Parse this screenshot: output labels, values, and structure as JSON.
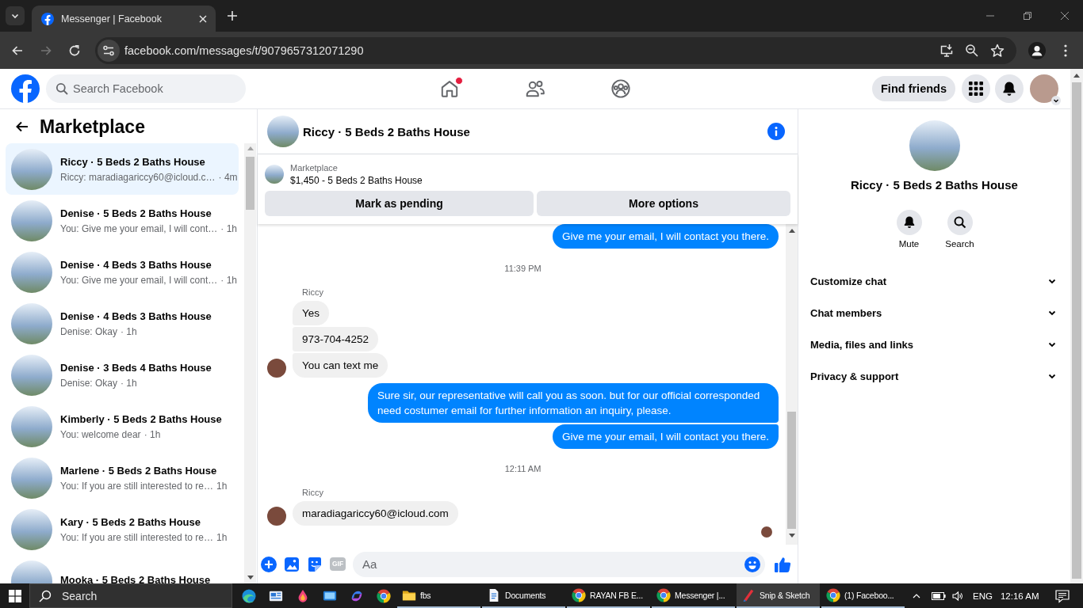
{
  "browser": {
    "tabs": [
      {
        "title": "Messenger | Facebook",
        "selected": true
      }
    ],
    "nav": [
      {
        "kind": "back",
        "disabled": false
      },
      {
        "kind": "forward",
        "disabled": true
      },
      {
        "kind": "reload",
        "disabled": false
      }
    ],
    "url": "facebook.com/messages/t/9079657312071290"
  },
  "header": {
    "search": {
      "placeholder": "Search Facebook"
    },
    "nav": [
      {
        "kind": "home",
        "notification": true
      },
      {
        "kind": "friends",
        "notification": false
      },
      {
        "kind": "groups",
        "notification": false
      }
    ],
    "find_friends": "Find friends"
  },
  "sidebar": {
    "title": "Marketplace",
    "conversations": [
      {
        "title": "Riccy · 5 Beds 2 Baths House",
        "preview": "Riccy: maradiagariccy60@icloud.c…",
        "time": "· 4m",
        "selected": true
      },
      {
        "title": "Denise · 5 Beds 2 Baths House",
        "preview": "You: Give me your email, I will cont…",
        "time": "· 1h",
        "selected": false
      },
      {
        "title": "Denise · 4 Beds 3 Baths House",
        "preview": "You: Give me your email, I will cont…",
        "time": "· 1h",
        "selected": false
      },
      {
        "title": "Denise · 4 Beds 3 Baths House",
        "preview": "Denise: Okay",
        "time": "· 1h",
        "selected": false
      },
      {
        "title": "Denise · 3 Beds 4 Baths House",
        "preview": "Denise: Okay",
        "time": "· 1h",
        "selected": false
      },
      {
        "title": "Kimberly · 5 Beds 2 Baths House",
        "preview": "You: welcome dear",
        "time": "· 1h",
        "selected": false
      },
      {
        "title": "Marlene · 5 Beds 2 Baths House",
        "preview": "You: If you are still interested to re…",
        "time": "1h",
        "selected": false
      },
      {
        "title": "Kary · 5 Beds 2 Baths House",
        "preview": "You: If you are still interested to re…",
        "time": "1h",
        "selected": false
      },
      {
        "title": "Mooka · 5 Beds 2 Baths House",
        "selected": false
      }
    ]
  },
  "chat": {
    "title": "Riccy · 5 Beds 2 Baths House",
    "listing": {
      "label": "Marketplace",
      "title": "$1,450 - 5 Beds 2 Baths House"
    },
    "actions": [
      "Mark as pending",
      "More options"
    ],
    "messages": [
      {
        "kind": "outgoing",
        "text": "Give me your email, I will contact you there."
      },
      {
        "kind": "timestamp",
        "text": "11:39 PM"
      },
      {
        "kind": "sender",
        "text": "Riccy"
      },
      {
        "kind": "incoming",
        "text": "Yes",
        "avatar": false
      },
      {
        "kind": "incoming",
        "text": "973-704-4252",
        "avatar": false
      },
      {
        "kind": "incoming",
        "text": "You can text me",
        "avatar": true
      },
      {
        "kind": "outgoing",
        "text": "Sure sir, our representative will call you as soon. but for our official corresponded need costumer email for further information an inquiry, please."
      },
      {
        "kind": "outgoing",
        "text": "Give me your email, I will contact you there."
      },
      {
        "kind": "timestamp",
        "text": "12:11 AM"
      },
      {
        "kind": "sender",
        "text": "Riccy"
      },
      {
        "kind": "incoming",
        "text": "maradiagariccy60@icloud.com",
        "avatar": true
      },
      {
        "kind": "seen"
      }
    ],
    "composer": {
      "tools": [
        {
          "kind": "plus"
        },
        {
          "kind": "image"
        },
        {
          "kind": "sticker"
        },
        {
          "kind": "gif",
          "label": "GIF"
        }
      ],
      "placeholder": "Aa"
    }
  },
  "details": {
    "title": "Riccy · 5 Beds 2 Baths House",
    "actions": [
      {
        "kind": "mute",
        "label": "Mute"
      },
      {
        "kind": "search",
        "label": "Search"
      }
    ],
    "sections": [
      {
        "label": "Customize chat",
        "expanded": false
      },
      {
        "label": "Chat members",
        "expanded": false
      },
      {
        "label": "Media, files and links",
        "expanded": false
      },
      {
        "label": "Privacy & support",
        "expanded": false
      }
    ]
  },
  "taskbar": {
    "search": {
      "placeholder": "Search"
    },
    "apps": [
      {
        "kind": "edge",
        "running": false,
        "selected": false
      },
      {
        "kind": "news",
        "running": false,
        "selected": false
      },
      {
        "kind": "drop",
        "running": false,
        "selected": false
      },
      {
        "kind": "screen",
        "running": false,
        "selected": false
      },
      {
        "kind": "loop",
        "running": false,
        "selected": false
      },
      {
        "kind": "chrome",
        "running": false,
        "selected": false
      },
      {
        "kind": "folder",
        "label": "fbs",
        "running": true,
        "selected": false
      },
      {
        "kind": "document",
        "label": "Documents",
        "running": true,
        "selected": false
      },
      {
        "kind": "chrome",
        "label": "RAYAN FB E...",
        "running": true,
        "selected": false
      },
      {
        "kind": "chrome",
        "label": "Messenger |...",
        "running": true,
        "selected": false
      },
      {
        "kind": "pen",
        "label": "Snip & Sketch",
        "running": true,
        "selected": true
      },
      {
        "kind": "chrome",
        "label": "(1) Faceboo...",
        "running": true,
        "selected": false
      }
    ],
    "tray": {
      "language": "ENG",
      "time": "12:16 AM"
    }
  }
}
